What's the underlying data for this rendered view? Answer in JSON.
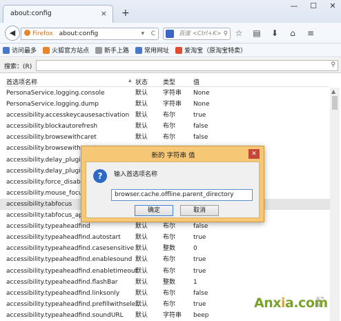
{
  "tab": {
    "title": "about:config",
    "close": "×",
    "new": "+"
  },
  "window": {
    "min": "—",
    "max": "☐",
    "close": "✕"
  },
  "nav": {
    "back": "◀",
    "identity": "Firefox",
    "url": "about:config",
    "dropdown": "▾",
    "reload": "C",
    "search_placeholder": "百度 <Ctrl+K>",
    "search_icon": "⚲"
  },
  "toolbar_icons": [
    "star-icon",
    "clipboard-icon",
    "download-icon",
    "home-icon",
    "menu-icon"
  ],
  "toolbar_glyphs": [
    "☆",
    "▤",
    "⬇",
    "⌂",
    "≡"
  ],
  "bookmarks": [
    {
      "label": "访问最多",
      "color": "#4a78c8"
    },
    {
      "label": "火狐官方站点",
      "color": "#e8862a"
    },
    {
      "label": "新手上路",
      "color": "#999999"
    },
    {
      "label": "常用网址",
      "color": "#4a78c8"
    },
    {
      "label": "爱淘宝（原淘宝特卖）",
      "color": "#e24c2c"
    }
  ],
  "filter": {
    "label": "搜索：(R)",
    "icon": "⚲"
  },
  "columns": {
    "name": "首选项名称",
    "status": "状态",
    "type": "类型",
    "value": "值"
  },
  "rows": [
    {
      "name": "PersonaService.logging.console",
      "status": "默认",
      "type": "字符串",
      "value": "None"
    },
    {
      "name": "PersonaService.logging.dump",
      "status": "默认",
      "type": "字符串",
      "value": "None"
    },
    {
      "name": "accessibility.accesskeycausesactivation",
      "status": "默认",
      "type": "布尔",
      "value": "true"
    },
    {
      "name": "accessibility.blockautorefresh",
      "status": "默认",
      "type": "布尔",
      "value": "false"
    },
    {
      "name": "accessibility.browsewithcaret",
      "status": "默认",
      "type": "布尔",
      "value": "false"
    },
    {
      "name": "accessibility.browsewithcaret_",
      "status": "",
      "type": "",
      "value": ""
    },
    {
      "name": "accessibility.delay_plugins",
      "status": "",
      "type": "",
      "value": ""
    },
    {
      "name": "accessibility.delay_plugin_",
      "status": "",
      "type": "",
      "value": ""
    },
    {
      "name": "accessibility.force_disable",
      "status": "",
      "type": "",
      "value": ""
    },
    {
      "name": "accessibility.mouse_focus",
      "status": "",
      "type": "",
      "value": ""
    },
    {
      "name": "accessibility.tabfocus",
      "status": "",
      "type": "",
      "value": ""
    },
    {
      "name": "accessibility.tabfocus_app",
      "status": "",
      "type": "",
      "value": ""
    },
    {
      "name": "accessibility.typeaheadfind",
      "status": "默认",
      "type": "布尔",
      "value": "false"
    },
    {
      "name": "accessibility.typeaheadfind.autostart",
      "status": "默认",
      "type": "布尔",
      "value": "true"
    },
    {
      "name": "accessibility.typeaheadfind.casesensitive",
      "status": "默认",
      "type": "整数",
      "value": "0"
    },
    {
      "name": "accessibility.typeaheadfind.enablesound",
      "status": "默认",
      "type": "布尔",
      "value": "true"
    },
    {
      "name": "accessibility.typeaheadfind.enabletimeout",
      "status": "默认",
      "type": "布尔",
      "value": "true"
    },
    {
      "name": "accessibility.typeaheadfind.flashBar",
      "status": "默认",
      "type": "整数",
      "value": "1"
    },
    {
      "name": "accessibility.typeaheadfind.linksonly",
      "status": "默认",
      "type": "布尔",
      "value": "false"
    },
    {
      "name": "accessibility.typeaheadfind.prefillwithsele...",
      "status": "默认",
      "type": "布尔",
      "value": "true"
    },
    {
      "name": "accessibility.typeaheadfind.soundURL",
      "status": "默认",
      "type": "字符串",
      "value": "beep"
    }
  ],
  "selected_row": 10,
  "dialog": {
    "title": "新的 字符串 值",
    "close": "✕",
    "prompt": "输入首选项名称",
    "value": "browser.cache.offline.parent_directory",
    "ok": "确定",
    "cancel": "取消"
  },
  "watermark": {
    "a": "Anx",
    "x": "i",
    "b": "a.com",
    "sub": "安下载"
  }
}
